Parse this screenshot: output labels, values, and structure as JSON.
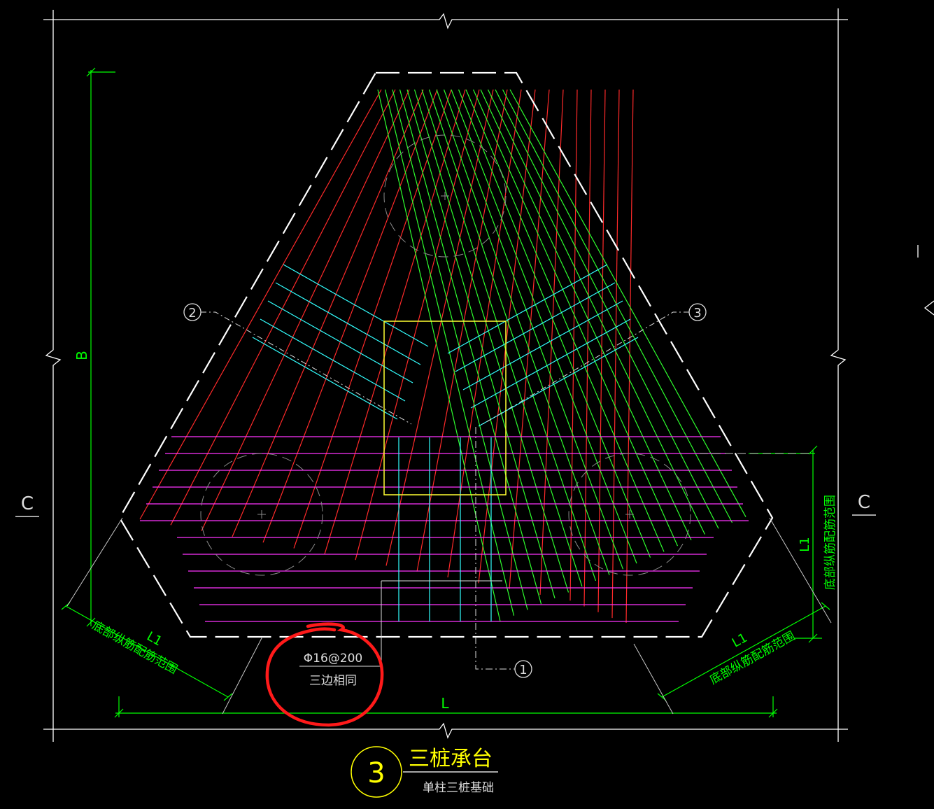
{
  "drawing": {
    "dimensions": {
      "height_label": "B",
      "width_label": "L",
      "side_label": "L1",
      "section_left": "C",
      "section_right": "C"
    },
    "callouts": {
      "c1": "1",
      "c2": "2",
      "c3": "3"
    },
    "range_notes": {
      "left": "底部纵筋配筋范围",
      "right": "底部纵筋配筋范围",
      "vertical": "底部纵筋配筋范围"
    },
    "rebar_note": {
      "spec": "Φ16@200",
      "remark": "三边相同"
    },
    "title_block": {
      "number": "3",
      "title": "三桩承台",
      "subtitle": "单柱三桩基础"
    },
    "colors": {
      "outline": "#ffffff",
      "rebar_red": "#ff2a2a",
      "rebar_green": "#2eff2e",
      "rebar_magenta": "#ff33ff",
      "rebar_cyan": "#33ffff",
      "column": "#ffff33",
      "dimension": "#00ff00",
      "annotation_circle": "#ff1a1a",
      "title_yellow": "#ffff00"
    }
  }
}
